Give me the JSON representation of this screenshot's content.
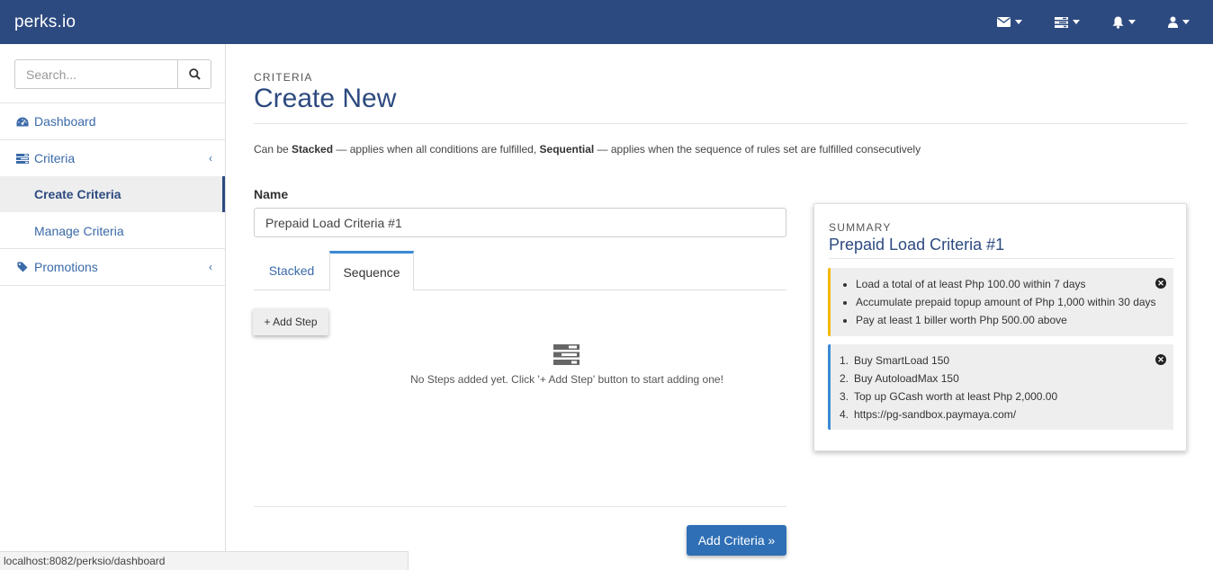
{
  "navbar": {
    "brand": "perks.io",
    "icons": [
      "envelope-icon",
      "tasks-icon",
      "bell-icon",
      "user-icon"
    ]
  },
  "sidebar": {
    "search_placeholder": "Search...",
    "items": [
      {
        "label": "Dashboard",
        "icon": "dashboard-icon"
      },
      {
        "label": "Criteria",
        "icon": "list-icon"
      },
      {
        "label": "Create Criteria"
      },
      {
        "label": "Manage Criteria"
      },
      {
        "label": "Promotions",
        "icon": "tag-icon"
      }
    ]
  },
  "main": {
    "eyebrow": "CRITERIA",
    "title": "Create New",
    "desc": {
      "p1": "Can be ",
      "stacked": "Stacked",
      "p2": " — applies when all conditions are fulfilled, ",
      "sequential": "Sequential",
      "p3": " — applies when the sequence of rules set are fulfilled consecutively"
    },
    "name_label": "Name",
    "name_value": "Prepaid Load Criteria #1",
    "tabs": [
      "Stacked",
      "Sequence"
    ],
    "add_step": "+ Add Step",
    "empty_text": "No Steps added yet. Click '+ Add Step' button to start adding one!",
    "submit": "Add Criteria »"
  },
  "summary": {
    "eyebrow": "SUMMARY",
    "title": "Prepaid Load Criteria #1",
    "stacked_rules": [
      "Load a total of at least Php 100.00 within 7 days",
      "Accumulate prepaid topup amount of Php 1,000 within 30 days",
      "Pay at least 1 biller worth Php 500.00 above"
    ],
    "sequence_rules": [
      "Buy SmartLoad 150",
      "Buy AutoloadMax 150",
      "Top up GCash worth at least Php 2,000.00",
      "https://pg-sandbox.paymaya.com/"
    ],
    "numbers": [
      "1.",
      "2.",
      "3.",
      "4."
    ]
  },
  "statusbar": "localhost:8082/perksio/dashboard",
  "colors": {
    "navbar": "#2d4a80",
    "accent": "#3a8ad6",
    "warning": "#f5b800",
    "primary_button": "#2f6fb5"
  }
}
